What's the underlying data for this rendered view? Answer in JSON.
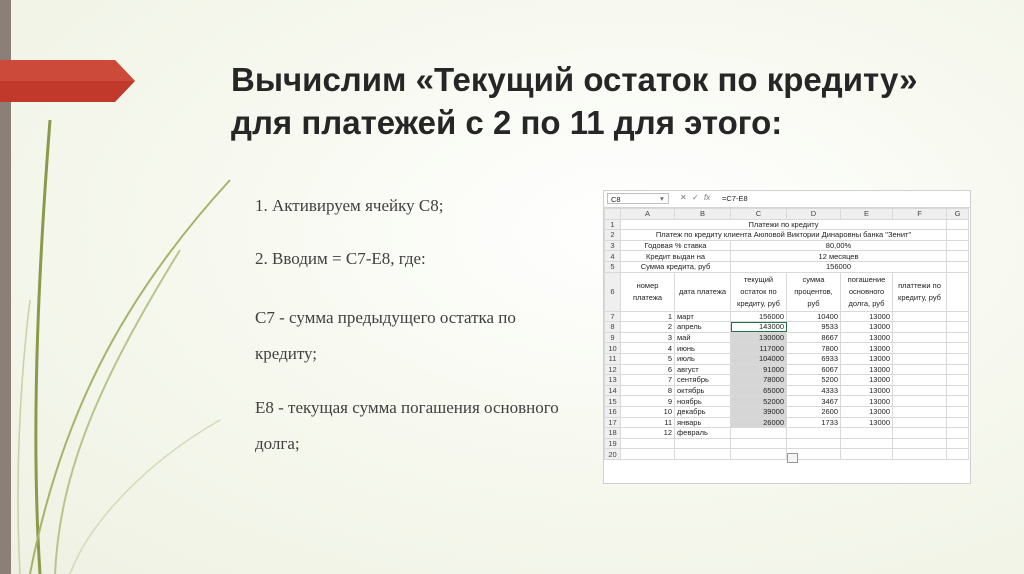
{
  "title": {
    "line1": "Вычислим «Текущий остаток по кредиту»",
    "line2": "для платежей с 2 по 11 для этого:"
  },
  "body": {
    "step1": "1. Активируем ячейку С8;",
    "step2": "2. Вводим = С7-Е8, где:",
    "c7": "С7 - сумма предыдущего остатка по кредиту;",
    "e8": "Е8 - текущая сумма погашения основного долга;"
  },
  "spreadsheet": {
    "name_box": "C8",
    "cancel_icon": "✕",
    "enter_icon": "✓",
    "fx": "fx",
    "formula": "=C7-E8",
    "columns": [
      "A",
      "B",
      "C",
      "D",
      "E",
      "F",
      "G"
    ],
    "info_rows": [
      {
        "n": "1",
        "text": "Платежи по кредиту"
      },
      {
        "n": "2",
        "text": "Платеж по кредиту клиента Аюповой Виктории Динаровны банка \"Зенит\""
      },
      {
        "n": "3",
        "label": "Годовая % ставка",
        "value": "80,00%"
      },
      {
        "n": "4",
        "label": "Кредит выдан на",
        "value": "12 месяцев"
      },
      {
        "n": "5",
        "label": "Сумма кредита, руб",
        "value": "156000"
      }
    ],
    "header_row": {
      "n": "6",
      "a": "номер платежа",
      "b": "дата платежа",
      "c": "текущий остаток по кредиту, руб",
      "d": "сумма процентов, руб",
      "e": "погашение основного долга, руб",
      "f": "платтежи по кредиту, руб"
    },
    "data_rows": [
      {
        "n": "7",
        "num": "1",
        "month": "март",
        "balance": "156000",
        "interest": "10400",
        "principal": "13000"
      },
      {
        "n": "8",
        "num": "2",
        "month": "апрель",
        "balance": "143000",
        "interest": "9533",
        "principal": "13000"
      },
      {
        "n": "9",
        "num": "3",
        "month": "май",
        "balance": "130000",
        "interest": "8667",
        "principal": "13000"
      },
      {
        "n": "10",
        "num": "4",
        "month": "июнь",
        "balance": "117000",
        "interest": "7800",
        "principal": "13000"
      },
      {
        "n": "11",
        "num": "5",
        "month": "июль",
        "balance": "104000",
        "interest": "6933",
        "principal": "13000"
      },
      {
        "n": "12",
        "num": "6",
        "month": "август",
        "balance": "91000",
        "interest": "6067",
        "principal": "13000"
      },
      {
        "n": "13",
        "num": "7",
        "month": "сентябрь",
        "balance": "78000",
        "interest": "5200",
        "principal": "13000"
      },
      {
        "n": "14",
        "num": "8",
        "month": "октябрь",
        "balance": "65000",
        "interest": "4333",
        "principal": "13000"
      },
      {
        "n": "15",
        "num": "9",
        "month": "ноябрь",
        "balance": "52000",
        "interest": "3467",
        "principal": "13000"
      },
      {
        "n": "16",
        "num": "10",
        "month": "декабрь",
        "balance": "39000",
        "interest": "2600",
        "principal": "13000"
      },
      {
        "n": "17",
        "num": "11",
        "month": "январь",
        "balance": "26000",
        "interest": "1733",
        "principal": "13000"
      },
      {
        "n": "18",
        "num": "12",
        "month": "февраль",
        "balance": "",
        "interest": "",
        "principal": ""
      }
    ],
    "extra_rows": [
      "19",
      "20"
    ]
  },
  "colors": {
    "accent": "#c0392b",
    "bar": "#8c7f78",
    "vine": "#8a9a4a"
  }
}
